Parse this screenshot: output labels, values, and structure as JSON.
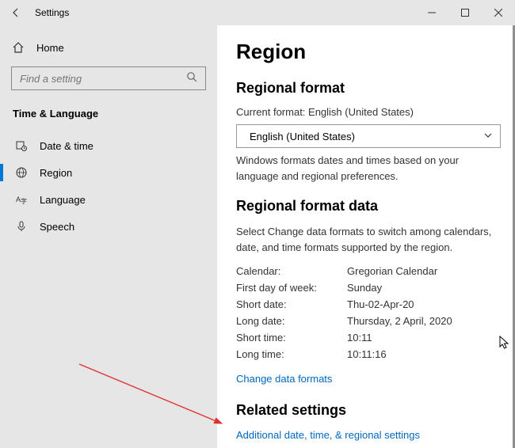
{
  "titlebar": {
    "title": "Settings"
  },
  "sidebar": {
    "home": "Home",
    "search_placeholder": "Find a setting",
    "section": "Time & Language",
    "items": [
      {
        "label": "Date & time"
      },
      {
        "label": "Region"
      },
      {
        "label": "Language"
      },
      {
        "label": "Speech"
      }
    ]
  },
  "main": {
    "heading": "Region",
    "format_heading": "Regional format",
    "current_format_label": "Current format: English (United States)",
    "dropdown_value": "English (United States)",
    "format_desc": "Windows formats dates and times based on your language and regional preferences.",
    "data_heading": "Regional format data",
    "data_desc": "Select Change data formats to switch among calendars, date, and time formats supported by the region.",
    "rows": [
      {
        "k": "Calendar:",
        "v": "Gregorian Calendar"
      },
      {
        "k": "First day of week:",
        "v": "Sunday"
      },
      {
        "k": "Short date:",
        "v": "Thu-02-Apr-20"
      },
      {
        "k": "Long date:",
        "v": "Thursday, 2 April, 2020"
      },
      {
        "k": "Short time:",
        "v": "10:11"
      },
      {
        "k": "Long time:",
        "v": "10:11:16"
      }
    ],
    "change_link": "Change data formats",
    "related_heading": "Related settings",
    "related_link": "Additional date, time, & regional settings"
  }
}
